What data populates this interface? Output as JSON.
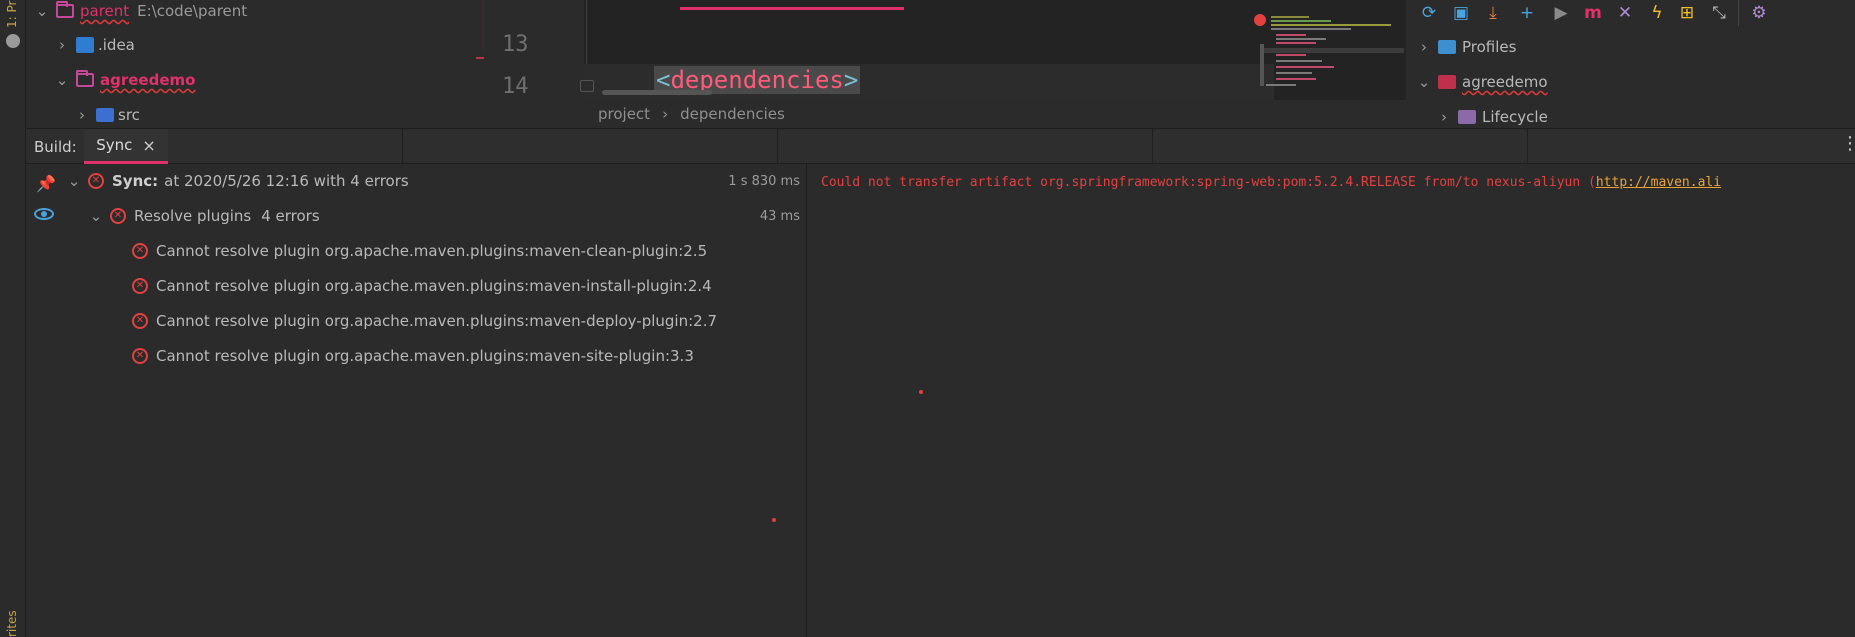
{
  "left_strip": {
    "top_tab": "1: Pr",
    "bottom_tab": "rites"
  },
  "project_tree": {
    "items": [
      {
        "label": "parent",
        "extra": "E:\\code\\parent"
      },
      {
        "label": ".idea"
      },
      {
        "label": "agreedemo"
      },
      {
        "label": "src"
      }
    ]
  },
  "editor": {
    "line_numbers": [
      "13",
      "14"
    ],
    "code_open": "<",
    "code_tag": "dependencies",
    "code_close": ">",
    "breadcrumb": [
      "project",
      "dependencies"
    ],
    "breadcrumb_sep": "›"
  },
  "maven": {
    "items": [
      {
        "label": "Profiles"
      },
      {
        "label": "agreedemo"
      },
      {
        "label": "Lifecycle"
      }
    ]
  },
  "build": {
    "label": "Build:",
    "tab": "Sync",
    "tab_close": "×",
    "sync_prefix": "Sync:",
    "sync_text": "at 2020/5/26 12:16 with 4 errors",
    "sync_time": "1 s 830 ms",
    "resolve_label": "Resolve plugins",
    "resolve_count": "4 errors",
    "resolve_time": "43 ms",
    "errors": [
      "Cannot resolve plugin org.apache.maven.plugins:maven-clean-plugin:2.5",
      "Cannot resolve plugin org.apache.maven.plugins:maven-install-plugin:2.4",
      "Cannot resolve plugin org.apache.maven.plugins:maven-deploy-plugin:2.7",
      "Cannot resolve plugin org.apache.maven.plugins:maven-site-plugin:3.3"
    ],
    "console_text": "Could not transfer artifact org.springframework:spring-web:pom:5.2.4.RELEASE from/to nexus-aliyun (",
    "console_link": "http://maven.ali"
  },
  "colors": {
    "accent": "#e0316a",
    "error": "#e34040",
    "link": "#e8a33a"
  }
}
